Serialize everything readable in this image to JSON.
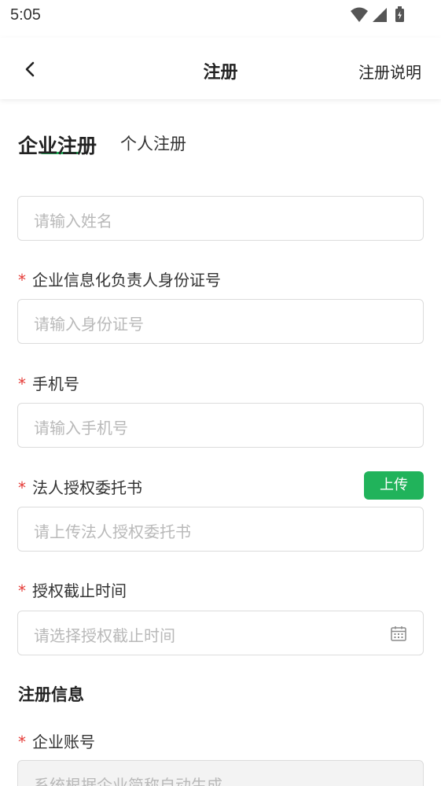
{
  "status_bar": {
    "time": "5:05"
  },
  "nav": {
    "title": "注册",
    "help_label": "注册说明"
  },
  "tabs": {
    "enterprise": "企业注册",
    "personal": "个人注册"
  },
  "fields": {
    "name": {
      "placeholder": "请输入姓名"
    },
    "id_card": {
      "label": "企业信息化负责人身份证号",
      "placeholder": "请输入身份证号"
    },
    "phone": {
      "label": "手机号",
      "placeholder": "请输入手机号"
    },
    "authorization": {
      "label": "法人授权委托书",
      "placeholder": "请上传法人授权委托书",
      "upload_label": "上传"
    },
    "auth_deadline": {
      "label": "授权截止时间",
      "placeholder": "请选择授权截止时间"
    }
  },
  "section": {
    "title": "注册信息"
  },
  "account": {
    "label": "企业账号",
    "placeholder": "系统根据企业简称自动生成"
  },
  "required_mark": "*",
  "colors": {
    "accent": "#21b35b",
    "required": "#e53935",
    "placeholder": "#b9b9b9"
  },
  "icons": {
    "back": "chevron-left-icon",
    "calendar": "calendar-icon",
    "wifi": "wifi-icon",
    "signal": "signal-icon",
    "battery": "battery-icon"
  }
}
